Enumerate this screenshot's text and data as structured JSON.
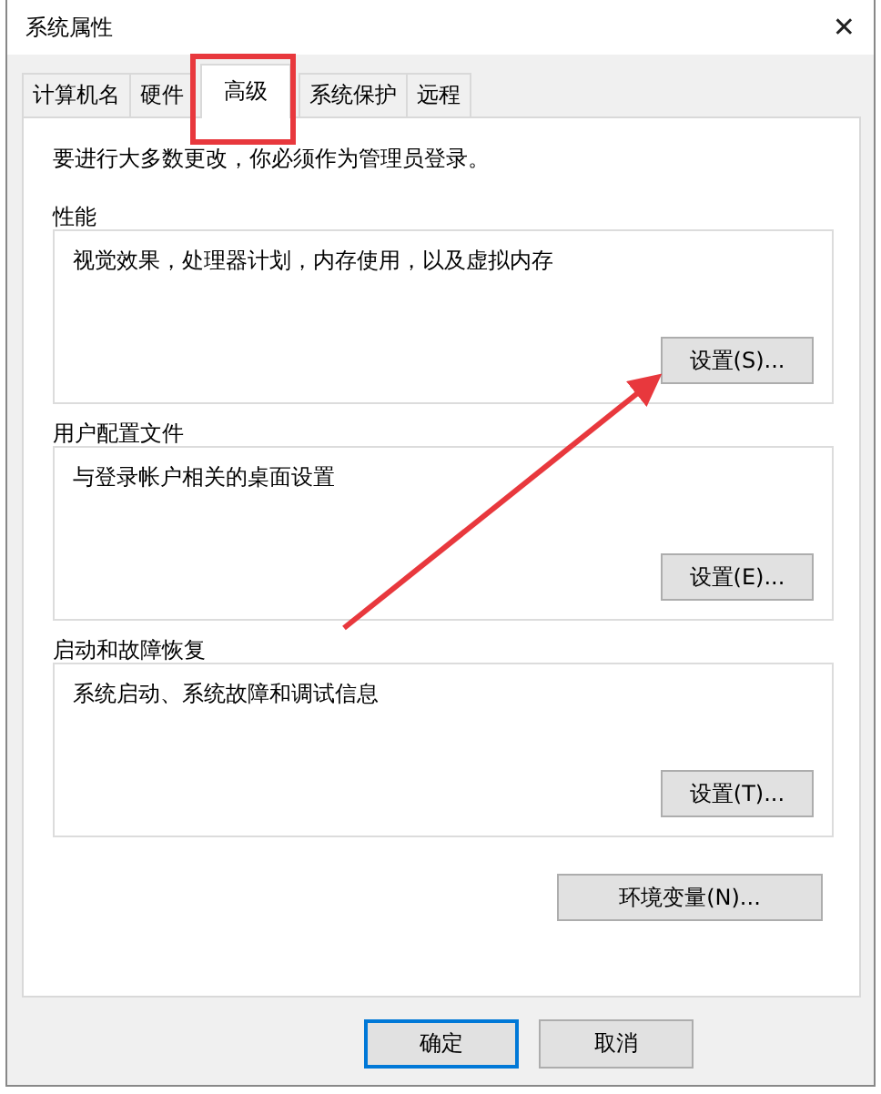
{
  "window": {
    "title": "系统属性",
    "close": "✕"
  },
  "tabs": [
    {
      "label": "计算机名",
      "selected": false
    },
    {
      "label": "硬件",
      "selected": false
    },
    {
      "label": "高级",
      "selected": true
    },
    {
      "label": "系统保护",
      "selected": false
    },
    {
      "label": "远程",
      "selected": false
    }
  ],
  "notice": "要进行大多数更改，你必须作为管理员登录。",
  "groups": [
    {
      "title": "性能",
      "description": "视觉效果，处理器计划，内存使用，以及虚拟内存",
      "button": "设置(S)..."
    },
    {
      "title": "用户配置文件",
      "description": "与登录帐户相关的桌面设置",
      "button": "设置(E)..."
    },
    {
      "title": "启动和故障恢复",
      "description": "系统启动、系统故障和调试信息",
      "button": "设置(T)..."
    }
  ],
  "env_button": "环境变量(N)...",
  "footer_buttons": [
    {
      "label": "确定",
      "kind": "default"
    },
    {
      "label": "取消",
      "kind": "normal"
    }
  ]
}
